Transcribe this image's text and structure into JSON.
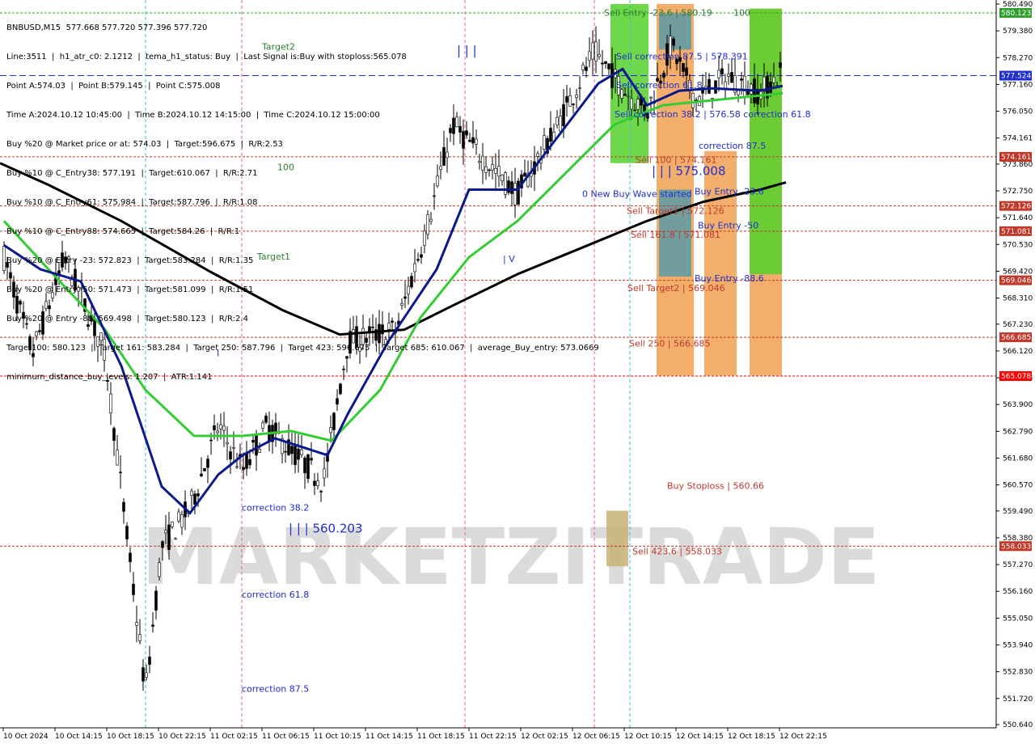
{
  "chart_data": {
    "type": "candlestick",
    "symbol_line": "BNBUSD,M15  577.668 577.720 577.396 577.720",
    "info_lines": [
      "Line:3511  |  h1_atr_c0: 2.1212  |  tema_h1_status: Buy  |  Last Signal is:Buy with stoploss:565.078",
      "Point A:574.03  |  Point B:579.145  |  Point C:575.008",
      "Time A:2024.10.12 10:45:00  |  Time B:2024.10.12 14:15:00  |  Time C:2024.10.12 15:00:00",
      "Buy %20 @ Market price or at: 574.03  |  Target:596.675  |  R/R:2.53",
      "Buy %10 @ C_Entry38: 577.191  |  Target:610.067  |  R/R:2.71",
      "Buy %10 @ C_Entry61: 575.984  |  Target:587.796  |  R/R:1.08",
      "Buy %10 @ C_Entry88: 574.665  |  Target:584.26  |  R/R:1",
      "Buy %20 @ Entry -23: 572.823  |  Target:583.284  |  R/R:1.35",
      "Buy %20 @ Entry -50: 571.473  |  Target:581.099  |  R/R:1.51",
      "Buy %20 @ Entry -88: 569.498  |  Target:580.123  |  R/R:2.4",
      "Target100: 580.123  |  Target 161: 583.284  |  Target 250: 587.796  |  Target 423: 596.675  |  Target 685: 610.067  |  average_Buy_entry: 573.0669",
      "minimum_distance_buy_levels: 1.207  |  ATR:1.141"
    ],
    "y_ticks": [
      "580.490",
      "579.380",
      "578.270",
      "577.160",
      "576.050",
      "574.161",
      "573.860",
      "572.750",
      "571.640",
      "570.530",
      "569.420",
      "568.310",
      "567.230",
      "566.120",
      "565.078",
      "563.900",
      "562.790",
      "561.680",
      "560.570",
      "559.490",
      "558.380",
      "557.270",
      "556.160",
      "555.050",
      "553.940",
      "552.830",
      "551.720",
      "550.640"
    ],
    "y_tick_values": [
      580.49,
      579.38,
      578.27,
      577.16,
      576.05,
      574.94,
      573.86,
      572.75,
      571.64,
      570.53,
      569.42,
      568.31,
      567.23,
      566.12,
      565.01,
      563.9,
      562.79,
      561.68,
      560.57,
      559.49,
      558.38,
      557.27,
      556.16,
      555.05,
      553.94,
      552.83,
      551.72,
      550.64
    ],
    "ylim": [
      550.64,
      580.49
    ],
    "x_ticks": [
      "10 Oct 2024",
      "10 Oct 14:15",
      "10 Oct 18:15",
      "10 Oct 22:15",
      "11 Oct 02:15",
      "11 Oct 06:15",
      "11 Oct 10:15",
      "11 Oct 14:15",
      "11 Oct 18:15",
      "11 Oct 22:15",
      "12 Oct 02:15",
      "12 Oct 06:15",
      "12 Oct 10:15",
      "12 Oct 14:15",
      "12 Oct 18:15",
      "12 Oct 22:15"
    ],
    "levels": [
      {
        "value": 580.123,
        "label": "580.123",
        "color": "#2e9e2e"
      },
      {
        "value": 577.524,
        "label": "577.524",
        "color": "#1f2fd1"
      },
      {
        "value": 574.161,
        "label": "574.161",
        "color": "#c0392b"
      },
      {
        "value": 572.126,
        "label": "572.126",
        "color": "#c0392b"
      },
      {
        "value": 571.081,
        "label": "571.081",
        "color": "#c0392b"
      },
      {
        "value": 569.046,
        "label": "569.046",
        "color": "#c0392b"
      },
      {
        "value": 566.685,
        "label": "566.685",
        "color": "#c0392b"
      },
      {
        "value": 565.078,
        "label": "565.078",
        "color": "#ff0000"
      },
      {
        "value": 558.033,
        "label": "558.033",
        "color": "#c0392b"
      }
    ],
    "annotations": [
      {
        "text": "Sell Entry -23.6 | 580.19",
        "value": 580.0,
        "color": "#2e7d32"
      },
      {
        "text": "100",
        "value": 580.0,
        "color": "#2e7d32"
      },
      {
        "text": "Target2",
        "value": 578.6,
        "color": "#2e7d32"
      },
      {
        "text": "Sell correction 87.5 | 578.391",
        "value": 578.2,
        "color": "#1f2fd1"
      },
      {
        "text": "Sell correction 61.8",
        "value": 577.0,
        "color": "#1f2fd1"
      },
      {
        "text": "Sell correction 38.2 | 576.58 correction 61.8",
        "value": 575.8,
        "color": "#1f2fd1"
      },
      {
        "text": "correction 87.5",
        "value": 574.5,
        "color": "#1f2fd1"
      },
      {
        "text": "Sell 100 | 574.161",
        "value": 573.9,
        "color": "#c0392b"
      },
      {
        "text": "100",
        "value": 573.6,
        "color": "#2e7d32"
      },
      {
        "text": "| | | 575.008",
        "value": 573.4,
        "color": "#1f2fd1"
      },
      {
        "text": "0 New Buy Wave started",
        "value": 572.5,
        "color": "#1f2fd1"
      },
      {
        "text": "Buy Entry -23.6",
        "value": 572.6,
        "color": "#1f2fd1"
      },
      {
        "text": "Sell Target1 | 572.126",
        "value": 571.8,
        "color": "#c0392b"
      },
      {
        "text": "Buy Entry -50",
        "value": 571.2,
        "color": "#1f2fd1"
      },
      {
        "text": "Sell 161.8 | 571.081",
        "value": 570.8,
        "color": "#c0392b"
      },
      {
        "text": "Target1",
        "value": 569.9,
        "color": "#2e7d32"
      },
      {
        "text": "Buy Entry -88.6",
        "value": 569.0,
        "color": "#1f2fd1"
      },
      {
        "text": "Sell Target2 | 569.046",
        "value": 568.6,
        "color": "#c0392b"
      },
      {
        "text": "Sell 250 | 566.685",
        "value": 566.3,
        "color": "#c0392b"
      },
      {
        "text": "Buy Stoploss | 560.66",
        "value": 560.4,
        "color": "#c0392b"
      },
      {
        "text": "correction 38.2",
        "value": 559.5,
        "color": "#1f2fd1"
      },
      {
        "text": "| | | 560.203",
        "value": 558.6,
        "color": "#1f2fd1"
      },
      {
        "text": "Sell 423.6 | 558.033",
        "value": 557.7,
        "color": "#c0392b"
      },
      {
        "text": "correction 61.8",
        "value": 555.9,
        "color": "#1f2fd1"
      },
      {
        "text": "correction 87.5",
        "value": 552.0,
        "color": "#1f2fd1"
      },
      {
        "text": "| | |",
        "value": 578.4,
        "color": "#1f2fd1"
      },
      {
        "text": "| V",
        "value": 569.8,
        "color": "#1f2fd1"
      },
      {
        "text": "I",
        "value": 565.9,
        "color": "#1f2fd1"
      }
    ],
    "watermark": "MARKETZITRADE"
  }
}
